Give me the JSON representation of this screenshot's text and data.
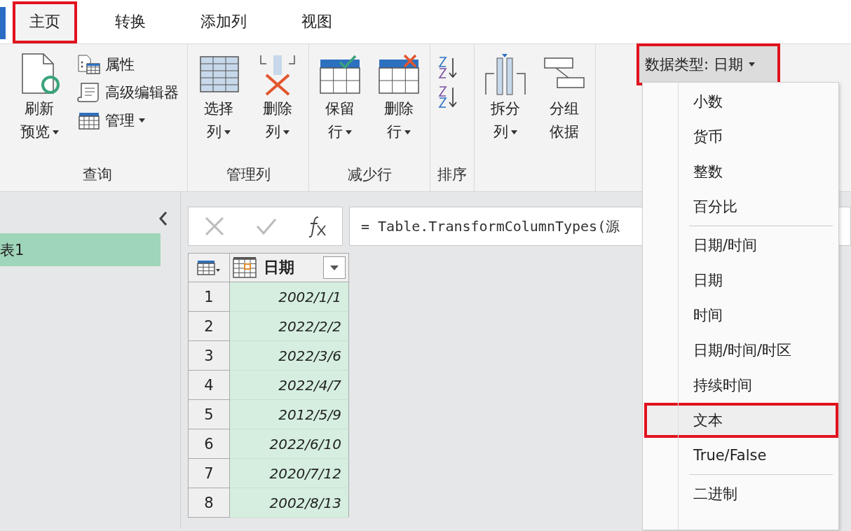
{
  "tabs": [
    {
      "label": "主页",
      "selected": true,
      "highlighted": true
    },
    {
      "label": "转换",
      "selected": false,
      "highlighted": false
    },
    {
      "label": "添加列",
      "selected": false,
      "highlighted": false
    },
    {
      "label": "视图",
      "selected": false,
      "highlighted": false
    }
  ],
  "ribbon": {
    "groups": [
      {
        "label": "查询",
        "items": [
          {
            "kind": "large",
            "lines": [
              "刷新",
              "预览"
            ],
            "dropdown": true
          },
          {
            "kind": "small",
            "lines": [
              "属性"
            ],
            "dropdown": false
          },
          {
            "kind": "small",
            "lines": [
              "高级编辑器"
            ],
            "dropdown": false
          },
          {
            "kind": "small",
            "lines": [
              "管理"
            ],
            "dropdown": true
          }
        ]
      },
      {
        "label": "管理列",
        "items": [
          {
            "kind": "large",
            "lines": [
              "选择",
              "列"
            ],
            "dropdown": true
          },
          {
            "kind": "large",
            "lines": [
              "删除",
              "列"
            ],
            "dropdown": true
          }
        ]
      },
      {
        "label": "减少行",
        "items": [
          {
            "kind": "large",
            "lines": [
              "保留",
              "行"
            ],
            "dropdown": true
          },
          {
            "kind": "large",
            "lines": [
              "删除",
              "行"
            ],
            "dropdown": true
          }
        ]
      },
      {
        "label": "排序",
        "items": [
          {
            "kind": "sort"
          }
        ]
      },
      {
        "items": [
          {
            "kind": "large",
            "lines": [
              "拆分",
              "列"
            ],
            "dropdown": true
          },
          {
            "kind": "large",
            "lines": [
              "分组",
              "依据"
            ],
            "dropdown": false
          }
        ]
      }
    ],
    "data_type_button": {
      "label": "数据类型: 日期",
      "dropdown": true,
      "highlighted": true
    }
  },
  "queries": {
    "items": [
      {
        "label": "表1",
        "selected": true
      }
    ]
  },
  "formula_bar": {
    "formula": "= Table.TransformColumnTypes(源"
  },
  "table": {
    "columns": [
      {
        "label": "日期"
      }
    ],
    "rows": [
      {
        "index": "1",
        "value": "2002/1/1"
      },
      {
        "index": "2",
        "value": "2022/2/2"
      },
      {
        "index": "3",
        "value": "2022/3/6"
      },
      {
        "index": "4",
        "value": "2022/4/7"
      },
      {
        "index": "5",
        "value": "2012/5/9"
      },
      {
        "index": "6",
        "value": "2022/6/10"
      },
      {
        "index": "7",
        "value": "2020/7/12"
      },
      {
        "index": "8",
        "value": "2002/8/13"
      }
    ]
  },
  "data_type_menu": {
    "items": [
      {
        "kind": "item",
        "label": "小数",
        "selected": false,
        "highlighted": false
      },
      {
        "kind": "item",
        "label": "货币",
        "selected": false,
        "highlighted": false
      },
      {
        "kind": "item",
        "label": "整数",
        "selected": false,
        "highlighted": false
      },
      {
        "kind": "item",
        "label": "百分比",
        "selected": false,
        "highlighted": false
      },
      {
        "kind": "separator"
      },
      {
        "kind": "item",
        "label": "日期/时间",
        "selected": false,
        "highlighted": false
      },
      {
        "kind": "item",
        "label": "日期",
        "selected": false,
        "highlighted": false
      },
      {
        "kind": "item",
        "label": "时间",
        "selected": false,
        "highlighted": false
      },
      {
        "kind": "item",
        "label": "日期/时间/时区",
        "selected": false,
        "highlighted": false
      },
      {
        "kind": "item",
        "label": "持续时间",
        "selected": false,
        "highlighted": false
      },
      {
        "kind": "item",
        "label": "文本",
        "selected": true,
        "highlighted": true
      },
      {
        "kind": "item",
        "label": "True/False",
        "selected": false,
        "highlighted": false
      },
      {
        "kind": "separator"
      },
      {
        "kind": "item",
        "label": "二进制",
        "selected": false,
        "highlighted": false
      }
    ]
  }
}
